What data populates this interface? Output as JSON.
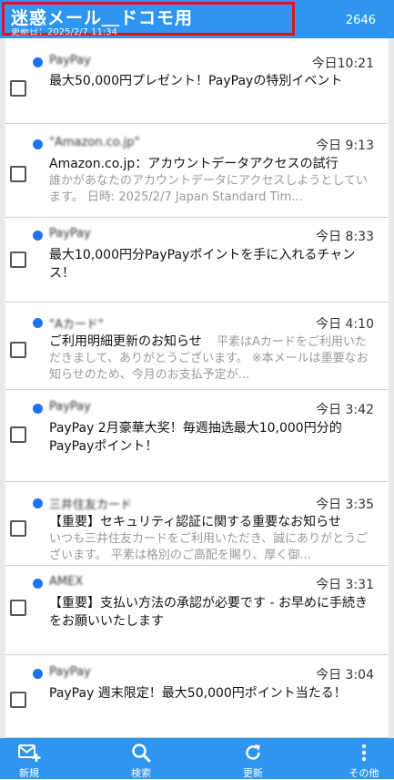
{
  "header": {
    "title": "迷惑メール＿ドコモ用",
    "updated": "更新日：2025/2/7 11:34",
    "count": "2646"
  },
  "messages": [
    {
      "sender": "PayPay",
      "time": "今日10:21",
      "subject": "最大50,000円プレゼント！PayPayの特別イベント",
      "preview": ""
    },
    {
      "sender": "\"Amazon.co.jp\"",
      "time": "今日 9:13",
      "subject": "Amazon.co.jp：アカウントデータアクセスの試行",
      "preview": "誰かがあなたのアカウントデータにアクセスしようとしています。 日時: 2025/2/7 Japan Standard Tim..."
    },
    {
      "sender": "PayPay",
      "time": "今日 8:33",
      "subject": "最大10,000円分PayPayポイントを手に入れるチャンス！",
      "preview": ""
    },
    {
      "sender": "\"Aカード\"",
      "time": "今日 4:10",
      "subject": "ご利用明細更新のお知らせ",
      "preview": "平素はAカードをご利用いただきまして、ありがとうございます。 ※本メールは重要なお知らせのため、今月のお支払予定が..."
    },
    {
      "sender": "PayPay",
      "time": "今日 3:42",
      "subject": "PayPay 2月豪華大奖！毎週抽选最大10,000円分的PayPayポイント！",
      "preview": ""
    },
    {
      "sender": "三井住友カード",
      "time": "今日 3:35",
      "subject": "【重要】セキュリティ認証に関する重要なお知らせ",
      "preview": "いつも三井住友カードをご利用いただき、誠にありがとうございます。 平素は格別のご高配を賜り、厚く御..."
    },
    {
      "sender": "AMEX",
      "time": "今日 3:31",
      "subject": "【重要】支払い方法の承認が必要です - お早めに手続きをお願いいたします",
      "preview": ""
    },
    {
      "sender": "PayPay",
      "time": "今日 3:04",
      "subject": "PayPay 週末限定！最大50,000円ポイント当たる！",
      "preview": ""
    }
  ],
  "bottom_nav": {
    "new": "新規",
    "search": "検索",
    "refresh": "更新",
    "more": "その他"
  },
  "colors": {
    "primary": "#2e96f0",
    "highlight_border": "#e0131e",
    "unread_dot": "#1e74f0"
  }
}
